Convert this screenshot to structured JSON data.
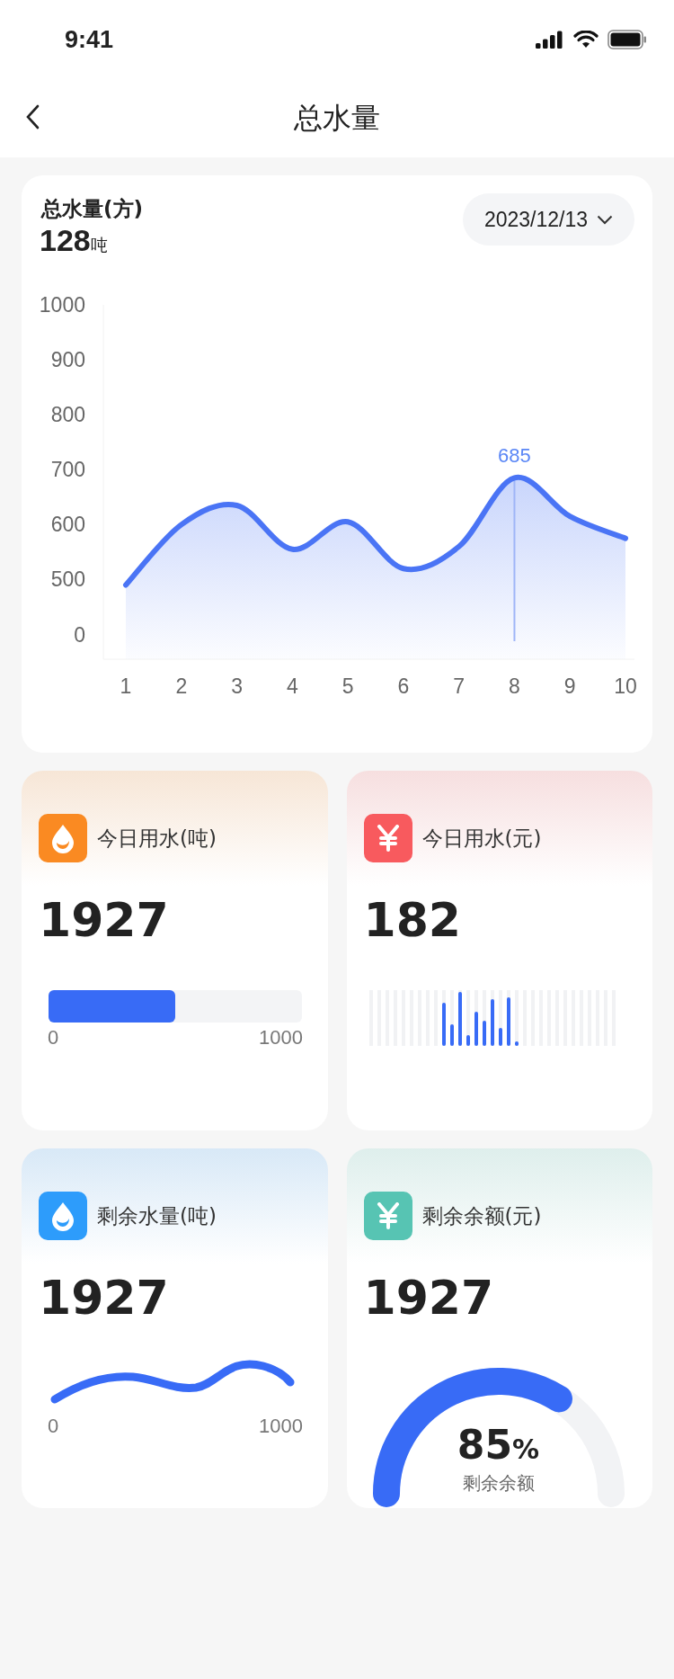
{
  "status_bar": {
    "time": "9:41"
  },
  "nav": {
    "title": "总水量"
  },
  "summary": {
    "title": "总水量(方)",
    "value": "128",
    "unit": "吨",
    "date": "2023/12/13",
    "chart_data": {
      "type": "area",
      "categories": [
        "1",
        "2",
        "3",
        "4",
        "5",
        "6",
        "7",
        "8",
        "9",
        "10"
      ],
      "series": [
        {
          "color": "#4a74f5",
          "values": [
            490,
            600,
            635,
            555,
            605,
            520,
            560,
            685,
            615,
            575
          ]
        }
      ],
      "ylim": [
        355,
        1000
      ],
      "yticks": [
        500,
        600,
        700,
        800,
        900,
        1000
      ],
      "annotations": [
        {
          "x": "8",
          "y": 685,
          "text": "685"
        }
      ]
    },
    "y_baseline_label": "0"
  },
  "cards": [
    {
      "kind": "progress",
      "color": "#fa8a22",
      "title": "今日用水(吨)",
      "value": "1927",
      "level": 0.5,
      "min_label": "0",
      "max_label": "1000"
    },
    {
      "kind": "bars",
      "color": "#f85a5e",
      "title": "今日用水(元)",
      "value": "182"
    },
    {
      "kind": "wave",
      "color": "#2d9cfb",
      "title": "剩余水量(吨)",
      "value": "1927",
      "min_label": "0",
      "max_label": "1000"
    },
    {
      "kind": "gauge",
      "color": "#57c4b3",
      "title": "剩余余额(元)",
      "value": "1927",
      "gauge_value": "85",
      "gauge_suffix": "%",
      "caption": "剩余余额"
    }
  ]
}
